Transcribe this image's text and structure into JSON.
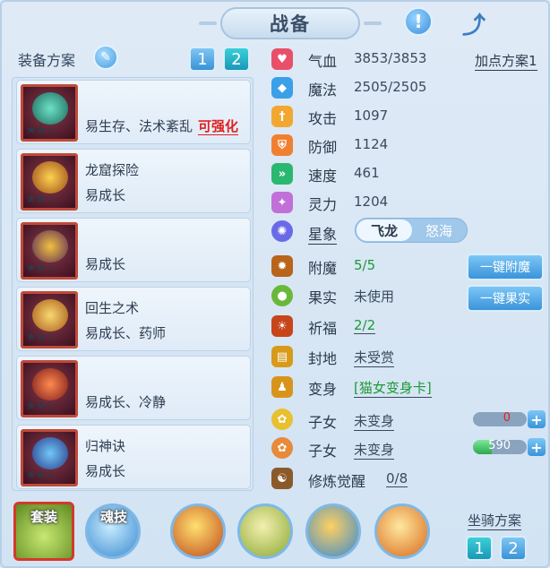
{
  "header": {
    "title": "战备",
    "alert_icon": "exclamation-icon",
    "share_icon": "share-icon"
  },
  "left": {
    "scheme_label": "装备方案",
    "scheme_buttons": [
      "1",
      "2"
    ],
    "equipment": [
      {
        "name": "",
        "desc": "易生存、法术紊乱",
        "tag": "可强化",
        "stars": "★★☆"
      },
      {
        "name": "龙窟探险",
        "desc": "易成长",
        "tag": "",
        "stars": "★★☆"
      },
      {
        "name": "",
        "desc": "易成长",
        "tag": "",
        "stars": "★★☆"
      },
      {
        "name": "回生之术",
        "desc": "易成长、药师",
        "tag": "",
        "stars": "★★☆"
      },
      {
        "name": "",
        "desc": "易成长、冷静",
        "tag": "",
        "stars": "★★☆"
      },
      {
        "name": "归神诀",
        "desc": "易成长",
        "tag": "",
        "stars": "★★☆"
      }
    ]
  },
  "skills": {
    "suit": "套装",
    "soul": "魂技",
    "mount_label": "坐骑方案",
    "mount_buttons": [
      "1",
      "2"
    ]
  },
  "stats": {
    "add_scheme": "加点方案1",
    "rows": [
      {
        "name": "气血",
        "value": "3853/3853",
        "color": "#e8506a"
      },
      {
        "name": "魔法",
        "value": "2505/2505",
        "color": "#3aa0e8"
      },
      {
        "name": "攻击",
        "value": "1097",
        "color": "#f2a830"
      },
      {
        "name": "防御",
        "value": "1124",
        "color": "#f08030"
      },
      {
        "name": "速度",
        "value": "461",
        "color": "#2ab870"
      },
      {
        "name": "灵力",
        "value": "1204",
        "color": "#c070d8"
      }
    ],
    "star_label": "星象",
    "star_options": [
      "飞龙",
      "怒海"
    ],
    "fumo": {
      "name": "附魔",
      "value": "5/5"
    },
    "guoshi": {
      "name": "果实",
      "value": "未使用"
    },
    "qifu": {
      "name": "祈福",
      "value": "2/2"
    },
    "fengdi": {
      "name": "封地",
      "value": "未受赏"
    },
    "bianshen": {
      "name": "变身",
      "value": "[猫女变身卡]"
    },
    "child1": {
      "name": "子女",
      "value": "未变身",
      "bar": "0",
      "fill_fraction": 0.0
    },
    "child2": {
      "name": "子女",
      "value": "未变身",
      "bar": "590",
      "fill_fraction": 0.35
    },
    "xiulian": {
      "name": "修炼觉醒",
      "value": "0/8"
    },
    "btn_fumo": "一键附魔",
    "btn_guoshi": "一键果实"
  }
}
